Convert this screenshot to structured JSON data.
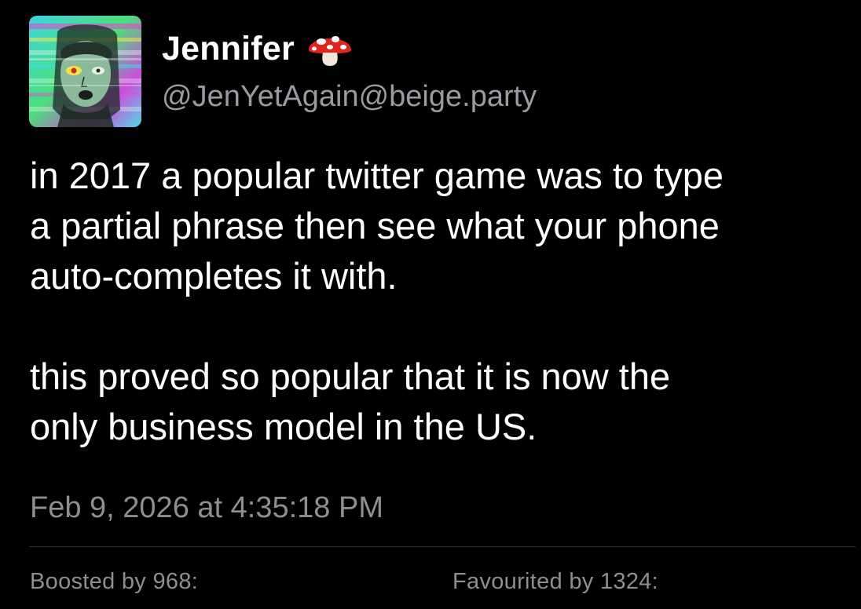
{
  "account": {
    "display_name": "Jennifer",
    "display_name_emoji_icon": "mushroom-icon",
    "handle": "@JenYetAgain@beige.party",
    "avatar_icon": "glitch-portrait-avatar"
  },
  "status": {
    "paragraphs": [
      "in 2017 a popular twitter game was to type\na partial phrase then see what your phone\nauto-completes it with.",
      "this proved so popular that it is now the\nonly business model in the US."
    ],
    "timestamp": "Feb 9, 2026 at 4:35:18 PM"
  },
  "stats": {
    "boosts_label": "Boosted by 968:",
    "favourites_label": "Favourited by 1324:"
  },
  "colors": {
    "background": "#000000",
    "text": "#ffffff",
    "secondary_text": "#8e8e93",
    "divider": "#2b2b2e"
  }
}
